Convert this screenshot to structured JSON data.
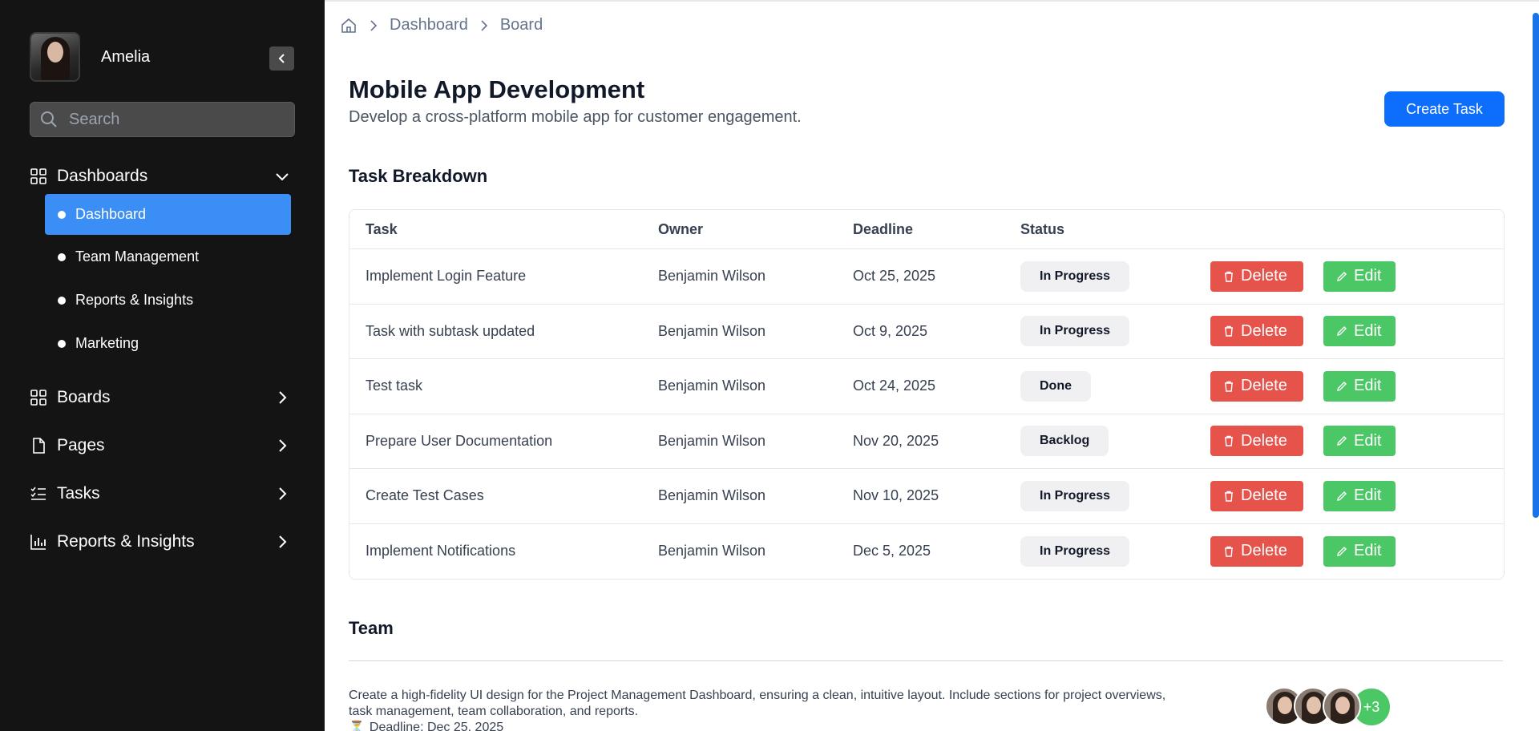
{
  "sidebar": {
    "user_name": "Amelia",
    "search_placeholder": "Search",
    "groups": [
      {
        "label": "Dashboards",
        "icon": "grid-icon",
        "expanded": true
      },
      {
        "label": "Boards",
        "icon": "grid-icon"
      },
      {
        "label": "Pages",
        "icon": "document-icon"
      },
      {
        "label": "Tasks",
        "icon": "checklist-icon"
      },
      {
        "label": "Reports & Insights",
        "icon": "bar-chart-icon"
      }
    ],
    "sub_items": [
      {
        "label": "Dashboard",
        "active": true
      },
      {
        "label": "Team Management"
      },
      {
        "label": "Reports & Insights"
      },
      {
        "label": "Marketing"
      }
    ]
  },
  "breadcrumb": [
    "Dashboard",
    "Board"
  ],
  "page": {
    "title": "Mobile App Development",
    "subtitle": "Develop a cross-platform mobile app for customer engagement.",
    "create_label": "Create Task"
  },
  "tasks_section": {
    "title": "Task Breakdown",
    "columns": [
      "Task",
      "Owner",
      "Deadline",
      "Status"
    ],
    "delete_label": "Delete",
    "edit_label": "Edit",
    "rows": [
      {
        "task": "Implement Login Feature",
        "owner": "Benjamin Wilson",
        "deadline": "Oct 25, 2025",
        "status": "In Progress"
      },
      {
        "task": "Task with subtask updated",
        "owner": "Benjamin Wilson",
        "deadline": "Oct 9, 2025",
        "status": "In Progress"
      },
      {
        "task": "Test task",
        "owner": "Benjamin Wilson",
        "deadline": "Oct 24, 2025",
        "status": "Done"
      },
      {
        "task": "Prepare User Documentation",
        "owner": "Benjamin Wilson",
        "deadline": "Nov 20, 2025",
        "status": "Backlog"
      },
      {
        "task": "Create Test Cases",
        "owner": "Benjamin Wilson",
        "deadline": "Nov 10, 2025",
        "status": "In Progress"
      },
      {
        "task": "Implement Notifications",
        "owner": "Benjamin Wilson",
        "deadline": "Dec 5, 2025",
        "status": "In Progress"
      }
    ]
  },
  "team": {
    "title": "Team",
    "description": "Create a high-fidelity UI design for the Project Management Dashboard, ensuring a clean, intuitive layout. Include sections for project overviews, task management, team collaboration, and reports.",
    "deadline": "Deadline: Dec 25, 2025",
    "more_count": "+3"
  },
  "colors": {
    "sidebar_bg": "#141414",
    "active_item": "#3b8ef5",
    "primary": "#0d6efd",
    "delete": "#e5534b",
    "edit": "#4cc766"
  }
}
